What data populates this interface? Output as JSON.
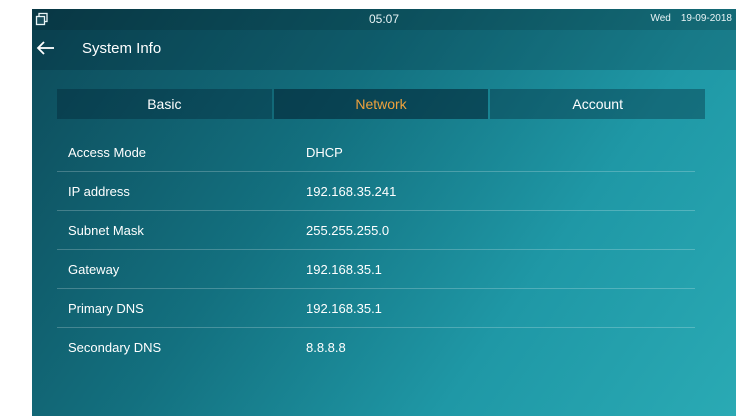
{
  "statusbar": {
    "time": "05:07",
    "day": "Wed",
    "date": "19-09-2018",
    "left_icon": "window-restore-icon"
  },
  "header": {
    "title": "System Info",
    "back_icon": "back-arrow-icon"
  },
  "tabs": [
    {
      "label": "Basic",
      "active": false
    },
    {
      "label": "Network",
      "active": true
    },
    {
      "label": "Account",
      "active": false
    }
  ],
  "network_info": [
    {
      "label": "Access Mode",
      "value": "DHCP"
    },
    {
      "label": "IP address",
      "value": "192.168.35.241"
    },
    {
      "label": "Subnet Mask",
      "value": "255.255.255.0"
    },
    {
      "label": "Gateway",
      "value": "192.168.35.1"
    },
    {
      "label": "Primary DNS",
      "value": "192.168.35.1"
    },
    {
      "label": "Secondary DNS",
      "value": "8.8.8.8"
    }
  ],
  "colors": {
    "active_tab_text": "#f0a23c",
    "background_dark": "#0d4a59",
    "background_light": "#2aaab4"
  }
}
